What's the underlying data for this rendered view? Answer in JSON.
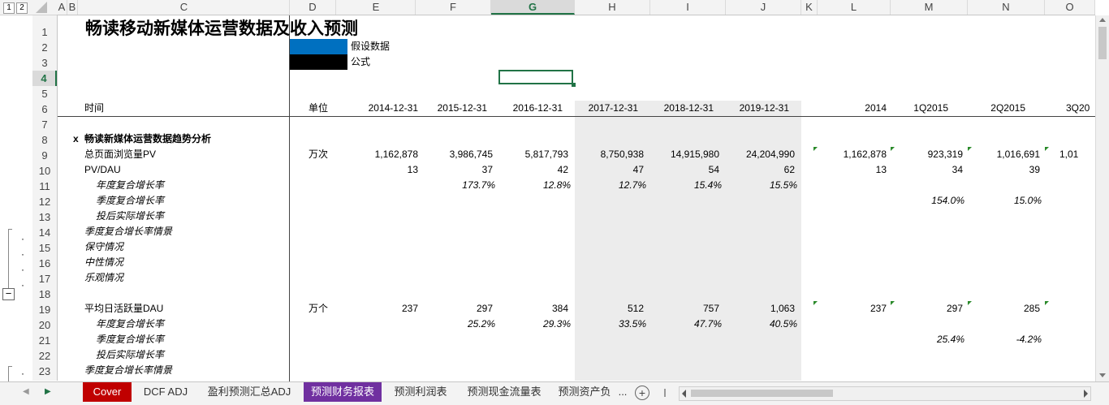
{
  "outline_levels": [
    "1",
    "2"
  ],
  "columns": [
    {
      "id": "A",
      "label": "A"
    },
    {
      "id": "B",
      "label": "B"
    },
    {
      "id": "C",
      "label": "C"
    },
    {
      "id": "D",
      "label": "D"
    },
    {
      "id": "E",
      "label": "E"
    },
    {
      "id": "F",
      "label": "F"
    },
    {
      "id": "G",
      "label": "G"
    },
    {
      "id": "H",
      "label": "H"
    },
    {
      "id": "I",
      "label": "I"
    },
    {
      "id": "J",
      "label": "J"
    },
    {
      "id": "K",
      "label": "K"
    },
    {
      "id": "L",
      "label": "L"
    },
    {
      "id": "M",
      "label": "M"
    },
    {
      "id": "N",
      "label": "N"
    },
    {
      "id": "O",
      "label": "O"
    }
  ],
  "selected_column": "G",
  "rows": [
    "1",
    "2",
    "3",
    "4",
    "5",
    "6",
    "7",
    "8",
    "9",
    "10",
    "11",
    "12",
    "13",
    "14",
    "15",
    "16",
    "17",
    "18",
    "19",
    "20",
    "21",
    "22",
    "23"
  ],
  "selected_row": "4",
  "sheet": {
    "title": "畅读移动新媒体运营数据及收入预测",
    "legend_assumption": "假设数据",
    "legend_formula": "公式",
    "header_time": "时间",
    "header_unit": "单位",
    "dates": [
      "2014-12-31",
      "2015-12-31",
      "2016-12-31",
      "2017-12-31",
      "2018-12-31",
      "2019-12-31"
    ],
    "periods": [
      "2014",
      "1Q2015",
      "2Q2015",
      "3Q20"
    ],
    "section_marker": "x",
    "section_title": "畅读新媒体运营数据趋势分析",
    "row9": {
      "label": "总页面浏览量PV",
      "unit": "万次",
      "vals": [
        "1,162,878",
        "3,986,745",
        "5,817,793",
        "8,750,938",
        "14,915,980",
        "24,204,990"
      ],
      "q": [
        "1,162,878",
        "923,319",
        "1,016,691",
        "1,01"
      ]
    },
    "row10": {
      "label": "PV/DAU",
      "vals": [
        "13",
        "37",
        "42",
        "47",
        "54",
        "62"
      ],
      "q": [
        "13",
        "34",
        "39"
      ]
    },
    "row11": {
      "label": "年度复合增长率",
      "vals": [
        "173.7%",
        "12.8%",
        "12.7%",
        "15.4%",
        "15.5%"
      ]
    },
    "row12": {
      "label": "季度复合增长率",
      "q": [
        "154.0%",
        "15.0%"
      ]
    },
    "row13": {
      "label": "投后实际增长率"
    },
    "row14": {
      "label": "季度复合增长率情景"
    },
    "row15": {
      "label": "保守情况"
    },
    "row16": {
      "label": "中性情况"
    },
    "row17": {
      "label": "乐观情况"
    },
    "row19": {
      "label": "平均日活跃量DAU",
      "unit": "万个",
      "vals": [
        "237",
        "297",
        "384",
        "512",
        "757",
        "1,063"
      ],
      "q": [
        "237",
        "297",
        "285"
      ]
    },
    "row20": {
      "label": "年度复合增长率",
      "vals": [
        "25.2%",
        "29.3%",
        "33.5%",
        "47.7%",
        "40.5%"
      ]
    },
    "row21": {
      "label": "季度复合增长率",
      "q": [
        "25.4%",
        "-4.2%"
      ]
    },
    "row22": {
      "label": "投后实际增长率"
    },
    "row23": {
      "label": "季度复合增长率情景"
    }
  },
  "colors": {
    "assumption": "#0070c0",
    "formula": "#000000",
    "accent": "#217346"
  },
  "tabs": [
    {
      "label": "Cover"
    },
    {
      "label": "DCF ADJ"
    },
    {
      "label": "盈利预测汇总ADJ"
    },
    {
      "label": "预测财务报表"
    },
    {
      "label": "预测利润表"
    },
    {
      "label": "预测现金流量表"
    },
    {
      "label": "预测资产负"
    }
  ],
  "tab_overflow": "...",
  "active_tab": "预测财务报表"
}
